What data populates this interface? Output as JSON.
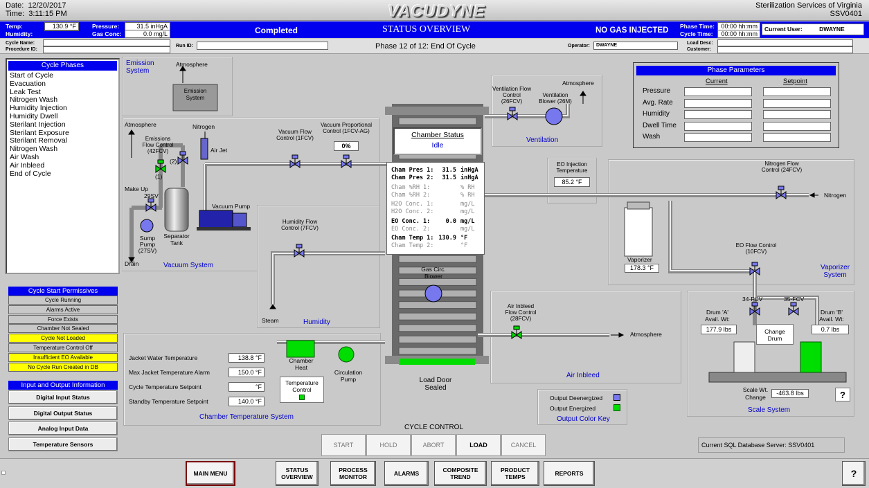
{
  "header": {
    "date_label": "Date:",
    "date": "12/20/2017",
    "time_label": "Time:",
    "time": "3:11:15 PM",
    "logo": "VACUDYNE",
    "company": "Sterilization Services of Virginia",
    "system_id": "SSV0401"
  },
  "status_bar": {
    "temp_label": "Temp:",
    "temp": "130.9 °F",
    "humidity_label": "Humidity:",
    "humidity": "",
    "pressure_label": "Pressure:",
    "pressure": "31.5 inHgA",
    "gasconc_label": "Gas Conc:",
    "gasconc": "0.0 mg/L",
    "cycle_state": "Completed",
    "title": "STATUS OVERVIEW",
    "gas_state": "NO GAS INJECTED",
    "phase_time_label": "Phase Time:",
    "phase_time": "00:00 hh:mm",
    "cycle_time_label": "Cycle Time:",
    "cycle_time": "00:00 hh:mm",
    "current_user_label": "Current User:",
    "current_user": "DWAYNE"
  },
  "info_bar": {
    "cycle_name_label": "Cycle Name:",
    "procedure_id_label": "Procedure ID:",
    "run_id_label": "Run ID:",
    "phase_text": "Phase 12 of 12:  End Of Cycle",
    "operator_label": "Operator:",
    "operator": "DWAYNE",
    "load_desc_label": "Load Desc:",
    "customer_label": "Customer:"
  },
  "cycle_phases": {
    "title": "Cycle Phases",
    "items": [
      "Start of Cycle",
      "Evacuation",
      "Leak Test",
      "Nitrogen Wash",
      "Humidity Injection",
      "Humidity Dwell",
      "Sterilant Injection",
      "Sterilant Exposure",
      "Sterilant Removal",
      "Nitrogen Wash",
      "Air Wash",
      "Air Inbleed",
      "End of Cycle"
    ]
  },
  "permissives": {
    "title": "Cycle Start Permissives",
    "items": [
      {
        "label": "Cycle Running",
        "color": "#c8c8c8"
      },
      {
        "label": "Alarms Active",
        "color": "#c8c8c8"
      },
      {
        "label": "Force Exists",
        "color": "#c8c8c8"
      },
      {
        "label": "Chamber Not Sealed",
        "color": "#c8c8c8"
      },
      {
        "label": "Cycle Not Loaded",
        "color": "#ffff00"
      },
      {
        "label": "Temperature Control Off",
        "color": "#c8c8c8"
      },
      {
        "label": "Insufficient EO Available",
        "color": "#ffff00"
      },
      {
        "label": "No Cycle Run Created in DB",
        "color": "#ffff00"
      }
    ]
  },
  "io_info": {
    "title": "Input and Output Information",
    "buttons": [
      "Digital Input Status",
      "Digital Output Status",
      "Analog Input Data",
      "Temperature Sensors"
    ]
  },
  "emission": {
    "title": "Emission System",
    "atmosphere": "Atmosphere",
    "box": "Emission System",
    "atm2": "Atmosphere",
    "flow": "Emissions Flow Control (42FCV)",
    "nitrogen": "Nitrogen",
    "airjet": "Air Jet",
    "n1": "(1)",
    "n2": "(2)"
  },
  "vacuum": {
    "title": "Vacuum System",
    "makeup": "Make Up",
    "v29": "29SV",
    "sump": "Sump Pump (27SV)",
    "drain": "Drain",
    "sep": "Separator Tank",
    "pump": "Vacuum Pump",
    "vfc": "Vacuum Flow Control (1FCV)",
    "vpc": "Vacuum Proportional Control (1FCV-AG)",
    "vpc_val": "0%"
  },
  "humidity": {
    "title": "Humidity",
    "hfc": "Humidity Flow Control (7FCV)",
    "steam": "Steam"
  },
  "chamber": {
    "status_title": "Chamber Status",
    "status": "Idle",
    "rows": [
      {
        "l": "Cham Pres 1:",
        "v": "31.5",
        "u": "inHgA",
        "on": true
      },
      {
        "l": "Cham Pres 2:",
        "v": "31.5",
        "u": "inHgA",
        "on": true
      },
      {
        "l": "Cham %RH 1:",
        "v": "",
        "u": "% RH",
        "on": false
      },
      {
        "l": "Cham %RH 2:",
        "v": "",
        "u": "% RH",
        "on": false
      },
      {
        "l": "H2O Conc. 1:",
        "v": "",
        "u": "mg/L",
        "on": false
      },
      {
        "l": "H2O Conc. 2:",
        "v": "",
        "u": "mg/L",
        "on": false
      },
      {
        "l": "EO Conc. 1:",
        "v": "0.0",
        "u": "mg/L",
        "on": true
      },
      {
        "l": "EO Conc. 2:",
        "v": "",
        "u": "mg/L",
        "on": false
      },
      {
        "l": "Cham Temp 1:",
        "v": "130.9",
        "u": "°F",
        "on": true
      },
      {
        "l": "Cham Temp 2:",
        "v": "",
        "u": "°F",
        "on": false
      }
    ],
    "blower": "Gas Circ. Blower",
    "door": "Load Door Sealed"
  },
  "ventilation": {
    "title": "Ventilation",
    "vfc": "Ventilation Flow Control (26FCV)",
    "blower": "Ventilation Blower (26M)",
    "atm": "Atmosphere"
  },
  "eo_injection": {
    "label": "EO Injection Temperature",
    "value": "85.2 °F"
  },
  "phase_params": {
    "title": "Phase Parameters",
    "current": "Current",
    "setpoint": "Setpoint",
    "rows": [
      "Pressure",
      "Avg. Rate",
      "Humidity",
      "Dwell Time",
      "Wash"
    ]
  },
  "vaporizer": {
    "title": "Vaporizer System",
    "nfc": "Nitrogen Flow Control (24FCV)",
    "nitrogen": "Nitrogen",
    "label": "Vaporizer",
    "value": "178.3 °F",
    "eofc": "EO Flow Control (10FCV)"
  },
  "air_inbleed": {
    "title": "Air Inbleed",
    "afc": "Air Inbleed Flow Control (28FCV)",
    "atm": "Atmosphere"
  },
  "scale": {
    "title": "Scale System",
    "v34": "34-FCV",
    "v35": "35-FCV",
    "drumA": "Drum 'A' Avail. Wt:",
    "drumA_val": "177.9 lbs",
    "drumB": "Drum 'B' Avail. Wt:",
    "drumB_val": "0.7 lbs",
    "change": "Change Drum",
    "swc": "Scale Wt. Change",
    "swc_val": "-463.8 lbs",
    "help": "?"
  },
  "temp_system": {
    "title": "Chamber Temperature System",
    "rows": [
      {
        "l": "Jacket Water Temperature",
        "v": "138.8 °F"
      },
      {
        "l": "Max Jacket Temperature Alarm",
        "v": "150.0 °F"
      },
      {
        "l": "Cycle Temperature Setpoint",
        "v": "°F"
      },
      {
        "l": "Standby Temperature Setpoint",
        "v": "140.0 °F"
      }
    ],
    "heat": "Chamber Heat",
    "pump": "Circulation Pump",
    "tc": "Temperature Control"
  },
  "legend": {
    "deenergized": "Output Deenergized",
    "energized": "Output Energized",
    "title": "Output Color Key"
  },
  "cycle_control": {
    "title": "CYCLE CONTROL",
    "buttons": [
      {
        "label": "START",
        "on": false
      },
      {
        "label": "HOLD",
        "on": false
      },
      {
        "label": "ABORT",
        "on": false
      },
      {
        "label": "LOAD",
        "on": true
      },
      {
        "label": "CANCEL",
        "on": false
      }
    ]
  },
  "sql": {
    "label": "Current SQL Database Server:",
    "value": "SSV0401"
  },
  "nav": {
    "main": "MAIN MENU",
    "items": [
      "STATUS OVERVIEW",
      "PROCESS MONITOR",
      "ALARMS",
      "COMPOSITE TREND",
      "PRODUCT TEMPS",
      "REPORTS"
    ],
    "help": "?"
  },
  "colors": {
    "blue": "#0000ee",
    "green": "#00dd00",
    "yellow": "#ffff00",
    "valve": "#7777ee"
  }
}
